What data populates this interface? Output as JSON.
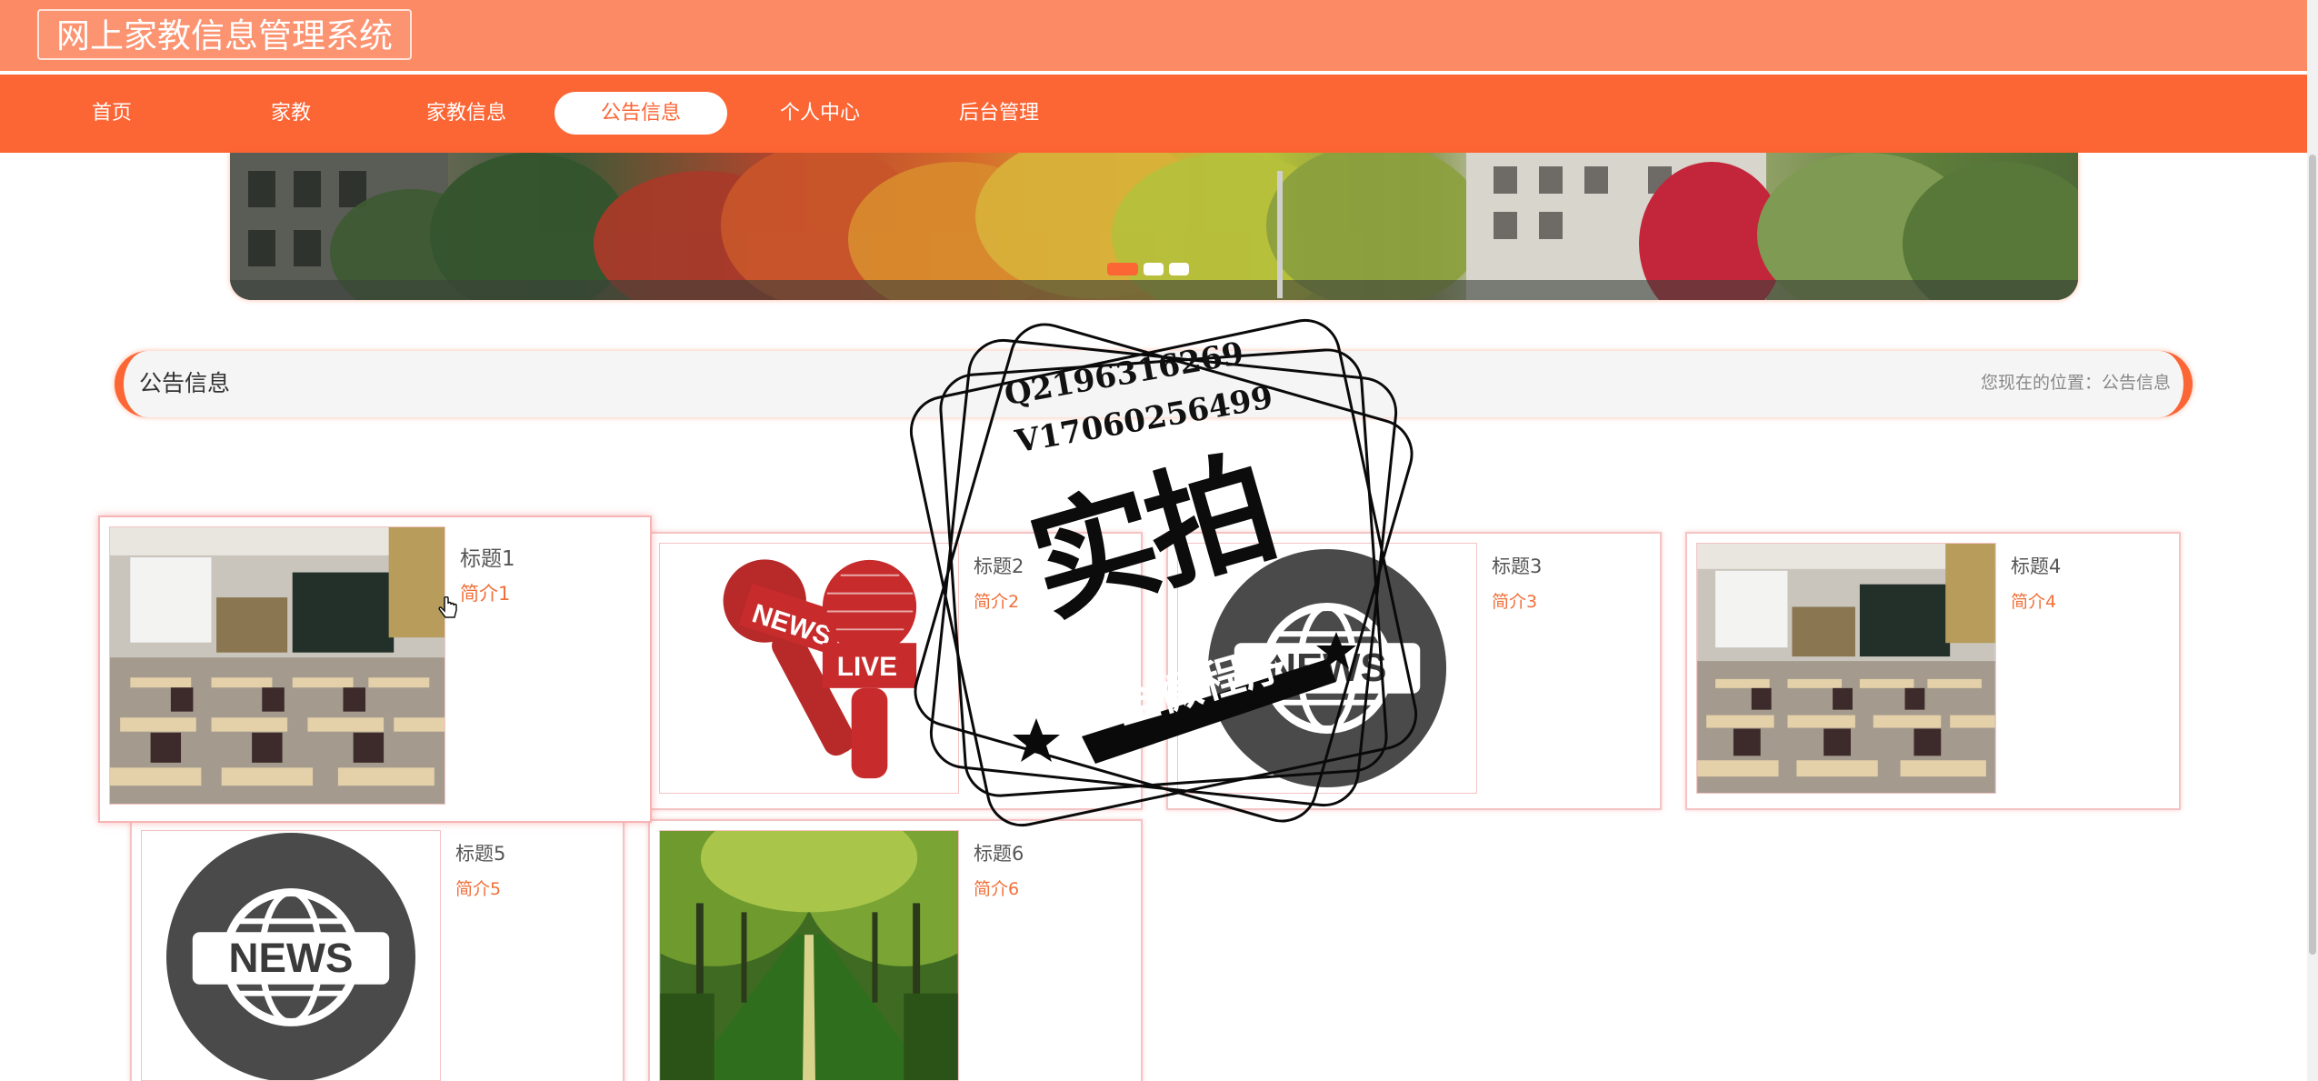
{
  "header": {
    "site_title": "网上家教信息管理系统"
  },
  "nav": {
    "items": [
      {
        "label": "首页"
      },
      {
        "label": "家教"
      },
      {
        "label": "家教信息"
      },
      {
        "label": "公告信息"
      },
      {
        "label": "个人中心"
      },
      {
        "label": "后台管理"
      }
    ],
    "active_index": 3
  },
  "banner": {
    "slide_count": 3,
    "active_slide": 1
  },
  "section": {
    "title": "公告信息",
    "breadcrumb": "您现在的位置：公告信息"
  },
  "cards": [
    {
      "title": "标题1",
      "desc": "简介1",
      "image": "classroom-photo"
    },
    {
      "title": "标题2",
      "desc": "简介2",
      "image": "news-microphone-illustration"
    },
    {
      "title": "标题3",
      "desc": "简介3",
      "image": "news-globe-icon"
    },
    {
      "title": "标题4",
      "desc": "简介4",
      "image": "classroom-photo"
    },
    {
      "title": "标题5",
      "desc": "简介5",
      "image": "news-globe-icon"
    },
    {
      "title": "标题6",
      "desc": "简介6",
      "image": "tree-lined-road-photo"
    }
  ],
  "image_text": {
    "news": "NEWS",
    "live": "LIVE"
  },
  "watermark": {
    "line1": "Q2196316269",
    "line2": "V17060256499",
    "main": "实拍",
    "ribbon": "全微程序"
  },
  "colors": {
    "header_bg": "#fc8a65",
    "nav_bg": "#fc6534",
    "accent": "#fc6534",
    "desc_text": "#f0703a",
    "card_border": "#f4c4c4"
  }
}
